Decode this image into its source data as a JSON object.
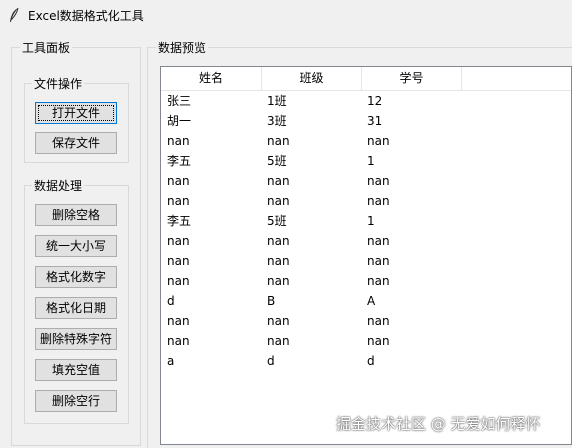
{
  "window": {
    "title": "Excel数据格式化工具",
    "icon": "feather-icon"
  },
  "toolpanel": {
    "label": "工具面板",
    "file_ops": {
      "label": "文件操作",
      "buttons": [
        {
          "label": "打开文件"
        },
        {
          "label": "保存文件"
        }
      ]
    },
    "data_ops": {
      "label": "数据处理",
      "buttons": [
        {
          "label": "删除空格"
        },
        {
          "label": "统一大小写"
        },
        {
          "label": "格式化数字"
        },
        {
          "label": "格式化日期"
        },
        {
          "label": "删除特殊字符"
        },
        {
          "label": "填充空值"
        },
        {
          "label": "删除空行"
        }
      ]
    }
  },
  "preview": {
    "label": "数据预览",
    "columns": [
      "姓名",
      "班级",
      "学号"
    ],
    "rows": [
      [
        "张三",
        "1班",
        "12"
      ],
      [
        "胡一",
        "3班",
        "31"
      ],
      [
        "nan",
        "nan",
        "nan"
      ],
      [
        "李五",
        "5班",
        "1"
      ],
      [
        "nan",
        "nan",
        "nan"
      ],
      [
        "nan",
        "nan",
        "nan"
      ],
      [
        "李五",
        "5班",
        "1"
      ],
      [
        "nan",
        "nan",
        "nan"
      ],
      [
        "nan",
        "nan",
        "nan"
      ],
      [
        "nan",
        "nan",
        "nan"
      ],
      [
        "d",
        "B",
        "A"
      ],
      [
        "nan",
        "nan",
        "nan"
      ],
      [
        "nan",
        "nan",
        "nan"
      ],
      [
        "a",
        "d",
        "d"
      ]
    ]
  },
  "watermark": "掘金技术社区 @ 无爱如何释怀"
}
